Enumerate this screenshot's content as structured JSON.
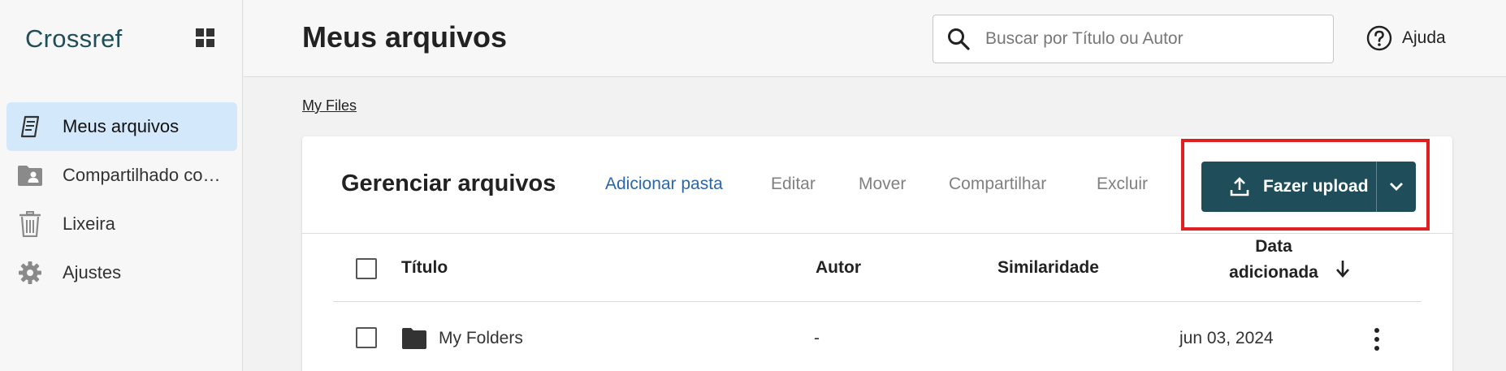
{
  "app": {
    "logo": "Crossref"
  },
  "sidebar": {
    "items": [
      {
        "label": "Meus arquivos",
        "icon": "files-icon",
        "active": true
      },
      {
        "label": "Compartilhado com...",
        "icon": "shared-folder-icon",
        "active": false
      },
      {
        "label": "Lixeira",
        "icon": "trash-icon",
        "active": false
      },
      {
        "label": "Ajustes",
        "icon": "gear-icon",
        "active": false
      }
    ]
  },
  "header": {
    "title": "Meus arquivos",
    "search_placeholder": "Buscar por Título ou Autor",
    "help_label": "Ajuda"
  },
  "breadcrumb": "My Files",
  "toolbar": {
    "title": "Gerenciar arquivos",
    "add_folder": "Adicionar pasta",
    "edit": "Editar",
    "move": "Mover",
    "share": "Compartilhar",
    "delete": "Excluir",
    "upload": "Fazer upload"
  },
  "table": {
    "columns": {
      "title": "Título",
      "author": "Autor",
      "similarity": "Similaridade",
      "date_line1": "Data",
      "date_line2": "adicionada"
    },
    "rows": [
      {
        "title": "My Folders",
        "author": "-",
        "similarity": "",
        "date": "jun 03, 2024",
        "type": "folder"
      }
    ]
  },
  "colors": {
    "accent": "#1f4e5a",
    "link": "#2a66a8",
    "active_nav": "#d3e8fb",
    "highlight_border": "#e02020"
  }
}
